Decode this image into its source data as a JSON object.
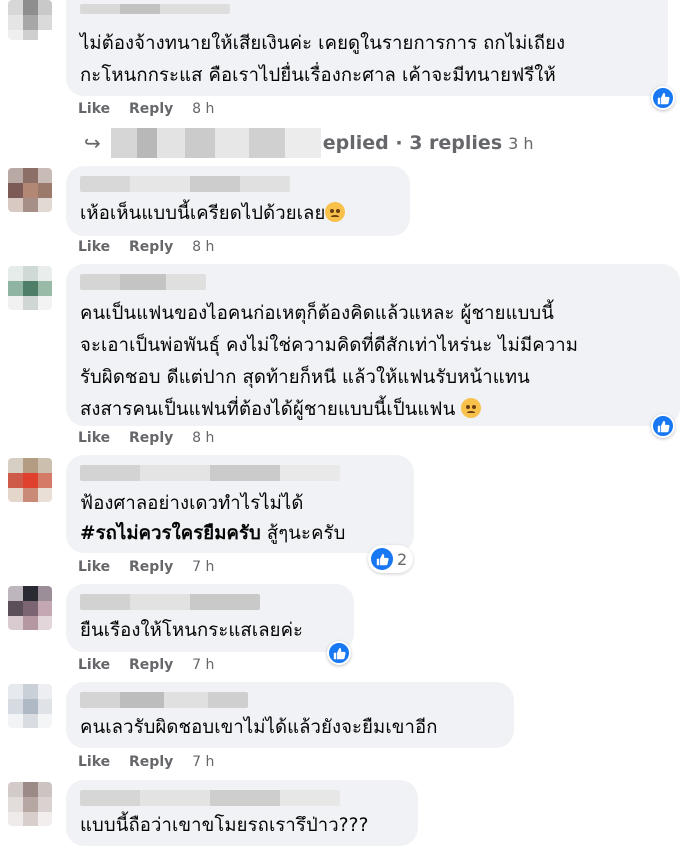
{
  "colors": {
    "bubble_bg": "#f0f2f5",
    "like_blue": "#1877f2",
    "meta_gray": "#65676b",
    "text": "#050505"
  },
  "actions": {
    "like_label": "Like",
    "reply_label": "Reply"
  },
  "comments": [
    {
      "lines": [
        "ไม่ต้องจ้างทนายให้เสียเงินค่ะ เคยดูในรายการการ ถกไม่เถียง",
        "กะโหนกกระแส คือเราไปยื่นเรื่องกะศาล เค้าจะมีทนายฟรีให้"
      ],
      "time": "8 h",
      "reaction_icon": "like-icon"
    },
    {
      "lines": [
        "เห้อเห็นแบบนี้เครียดไปด้วยเลย"
      ],
      "emoji": "anguished-face-emoji",
      "time": "8 h"
    },
    {
      "lines": [
        "คนเป็นแฟนของไอคนก่อเหตุก็ต้องคิดแล้วแหละ ผู้ชายแบบนี้",
        "จะเอาเป็นพ่อพันธุ์ คงไม่ใช่ความคิดที่ดีสักเท่าไหร่นะ ไม่มีความ",
        "รับผิดชอบ ดีแต่ปาก สุดท้ายก็หนี แล้วให้แฟนรับหน้าแทน",
        "สงสารคนเป็นแฟนที่ต้องได้ผู้ชายแบบนี้เป็นแฟน"
      ],
      "emoji": "relieved-face-emoji",
      "time": "8 h",
      "reaction_icon": "like-icon"
    },
    {
      "lines": [
        "ฟ้องศาลอย่างเดวทำไรไม่ได้"
      ],
      "hashtag": "#รถไม่ควรใครยืมครับ",
      "hashtag_suffix": " สู้ๆนะครับ",
      "time": "7 h",
      "reaction_count": "2"
    },
    {
      "lines": [
        "ยืนเรืองให้โหนกระแสเลยค่ะ"
      ],
      "time": "7 h",
      "reaction_icon": "like-icon"
    },
    {
      "lines": [
        "คนเลวรับผิดชอบเขาไม่ได้แล้วยังจะยืมเขาอีก"
      ],
      "time": "7 h"
    },
    {
      "lines": [
        "แบบนี้ถือว่าเขาขโมยรถเรารึป่าว???"
      ]
    }
  ],
  "replies_row": {
    "text": "eplied · 3 replies",
    "time": "3 h"
  }
}
